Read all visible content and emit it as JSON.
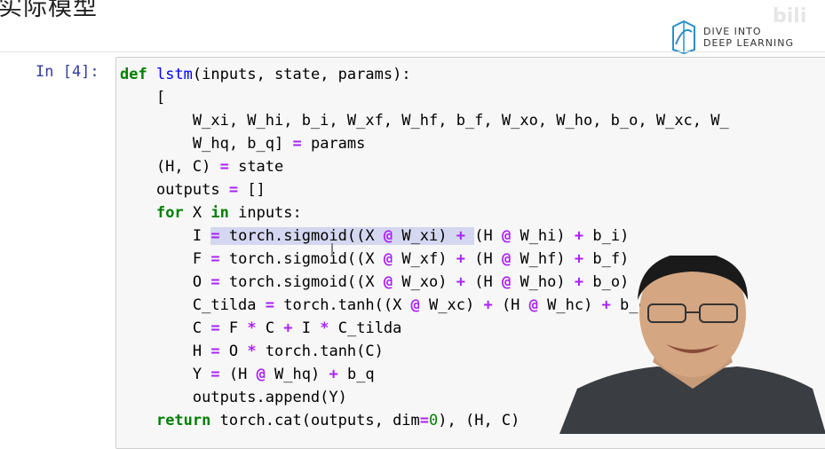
{
  "slide": {
    "title": "实际模型",
    "logo_line1": "DIVE INTO",
    "logo_line2": "DEEP LEARNING",
    "watermark": "bili"
  },
  "cell": {
    "prompt": "In [4]:",
    "lines": [
      "def lstm(inputs, state, params):",
      "    [",
      "        W_xi, W_hi, b_i, W_xf, W_hf, b_f, W_xo, W_ho, b_o, W_xc, W_",
      "        W_hq, b_q] = params",
      "    (H, C) = state",
      "    outputs = []",
      "    for X in inputs:",
      "        I = torch.sigmoid((X @ W_xi) + (H @ W_hi) + b_i)",
      "        F = torch.sigmoid((X @ W_xf) + (H @ W_hf) + b_f)",
      "        O = torch.sigmoid((X @ W_xo) + (H @ W_ho) + b_o)",
      "        C_tilda = torch.tanh((X @ W_xc) + (H @ W_hc) + b_c)",
      "        C = F * C + I * C_tilda",
      "        H = O * torch.tanh(C)",
      "        Y = (H @ W_hq) + b_q",
      "        outputs.append(Y)",
      "    return torch.cat(outputs, dim=0), (H, C)"
    ]
  },
  "colors": {
    "keyword": "#008000",
    "function_name": "#0000ff",
    "operator": "#aa22ff",
    "prompt": "#303f9f",
    "selection": "#d4d7ef"
  }
}
